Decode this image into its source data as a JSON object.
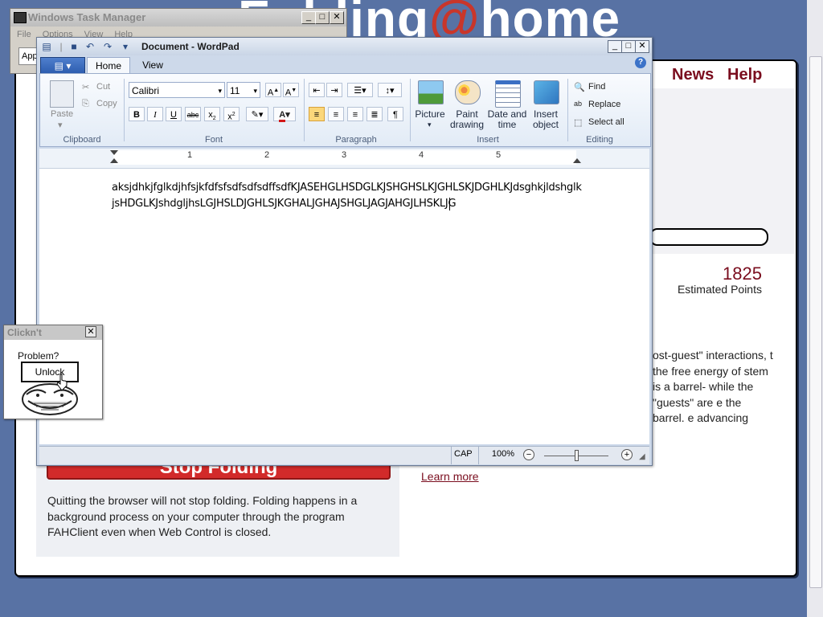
{
  "background_page": {
    "logo_text": "Folding@home",
    "logo_prefix": "Folding",
    "logo_at": "@",
    "logo_suffix": "home",
    "nav": {
      "news": "News",
      "help": "Help"
    },
    "points_value": "1825",
    "points_label": "Estimated Points",
    "right_paragraph": "ost-guest\" interactions, t the free energy of stem is a barrel- while the \"guests\" are e the barrel. e advancing",
    "stop_button": "Stop Folding",
    "learn_more": "Learn more",
    "quit_paragraph": "Quitting the browser will not stop folding. Folding happens in a background process on your computer through the program FAHClient even when Web Control is closed."
  },
  "task_manager": {
    "title": "Windows Task Manager",
    "menu": [
      "File",
      "Options",
      "View",
      "Help"
    ],
    "tab_partial": "App"
  },
  "wordpad": {
    "title": "Document - WordPad",
    "tabs": {
      "home": "Home",
      "view": "View"
    },
    "clipboard": {
      "paste": "Paste",
      "cut": "Cut",
      "copy": "Copy",
      "group": "Clipboard"
    },
    "font": {
      "family": "Calibri",
      "size": "11",
      "group": "Font"
    },
    "paragraph": {
      "group": "Paragraph"
    },
    "insert": {
      "picture": "Picture",
      "paint_line1": "Paint",
      "paint_line2": "drawing",
      "date_line1": "Date and",
      "date_line2": "time",
      "insert_line1": "Insert",
      "insert_line2": "object",
      "group": "Insert"
    },
    "editing": {
      "find": "Find",
      "replace": "Replace",
      "select_all": "Select all",
      "group": "Editing"
    },
    "ruler_numbers": [
      "1",
      "2",
      "3",
      "4",
      "5"
    ],
    "document": {
      "line1": "aksjdhkjfglkdjhfsjkfdfsfsdfsdfsdffsdfKJASEHGLHSDGLKJSHGHSLKJGHLSKJDGHLKJdsghkjldshglk",
      "line2": "jsHDGLKJshdgljhsLGJHSLDJGHLSJKGHALJGHAJSHGLJAGJAHGJLHSKLJG"
    },
    "status": {
      "cap": "CAP",
      "zoom": "100%"
    }
  },
  "clickn": {
    "title": "Clickn't",
    "question": "Problem?",
    "button": "Unlock"
  }
}
